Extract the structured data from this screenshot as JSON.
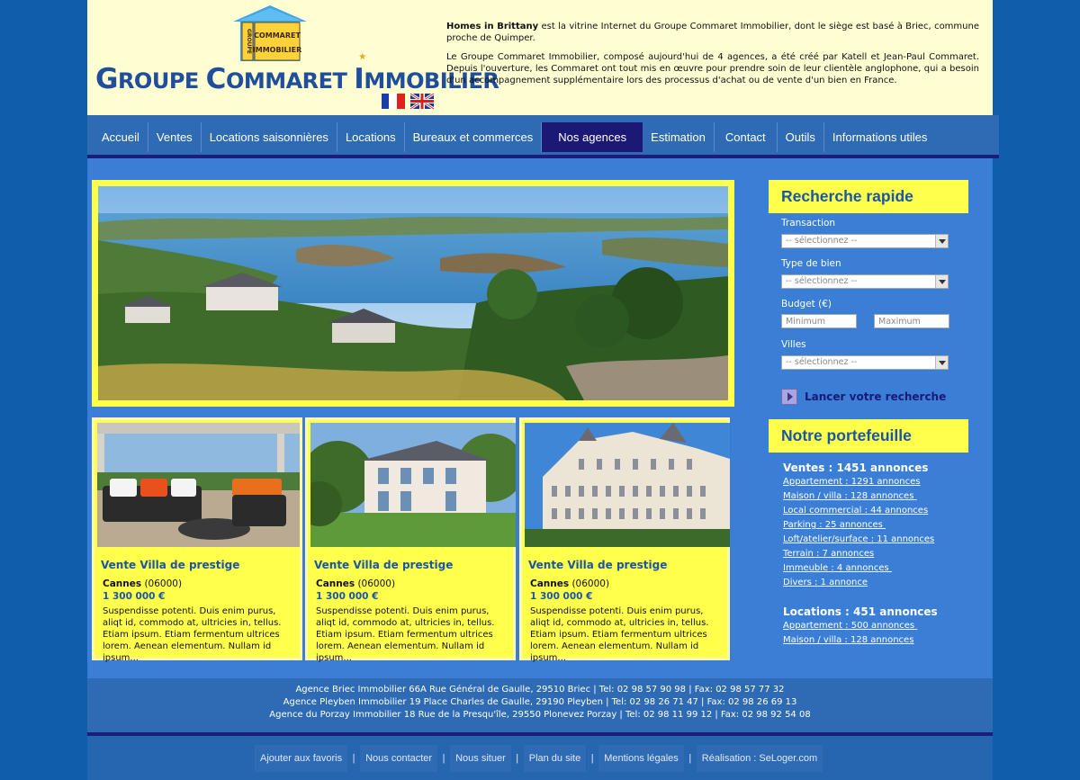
{
  "header": {
    "logo_line1": "COMMARET",
    "logo_line2": "IMMOBILIER",
    "logo_side": "GROUPE",
    "brand_G": "G",
    "brand_roupe": "ROUPE",
    "brand_C": "C",
    "brand_ommaret": "OMMARET",
    "brand_I": "I",
    "brand_mmobilier": "MMOBILIER",
    "intro_strong": "Homes in Brittany",
    "intro_p1": " est la vitrine Internet du Groupe Commaret Immobilier, dont le siège est basé à Briec, commune proche de Quimper.",
    "intro_p2": "Le Groupe Commaret Immobilier, composé aujourd'hui de 4 agences, a été créé par Katell et Jean-Paul Commaret. Depuis l'ouverture, les Commaret ont tout mis en œuvre pour prendre soin de leur clientèle anglophone, qui a besoin d'un accompagnement supplémentaire lors des processus d'achat ou de vente d'un bien en France."
  },
  "nav": {
    "items": [
      {
        "label": "Accueil"
      },
      {
        "label": "Ventes"
      },
      {
        "label": "Locations saisonnières"
      },
      {
        "label": "Locations"
      },
      {
        "label": "Bureaux et commerces"
      },
      {
        "label": "Nos agences"
      },
      {
        "label": "Estimation"
      },
      {
        "label": "Contact"
      },
      {
        "label": "Outils"
      },
      {
        "label": "Informations utiles"
      }
    ],
    "active": "Nos agences"
  },
  "cards": [
    {
      "title": "Vente Villa de prestige",
      "city": "Cannes",
      "zip": " (06000)",
      "price": "1 300 000 €",
      "desc": "Suspendisse potenti. Duis enim purus, aliqt id, commodo at, ultricies in, tellus. Etiam ipsum. Etiam fermentum ultrices lorem. Aenean elementum. Nullam id ipsum..."
    },
    {
      "title": "Vente Villa de prestige",
      "city": "Cannes",
      "zip": " (06000)",
      "price": "1 300 000 €",
      "desc": "Suspendisse potenti. Duis enim purus, aliqt id, commodo at, ultricies in, tellus. Etiam ipsum. Etiam fermentum ultrices lorem. Aenean elementum. Nullam id ipsum..."
    },
    {
      "title": "Vente Villa de prestige",
      "city": "Cannes",
      "zip": " (06000)",
      "price": "1 300 000 €",
      "desc": "Suspendisse potenti. Duis enim purus, aliqt id, commodo at, ultricies in, tellus. Etiam ipsum. Etiam fermentum ultrices lorem. Aenean elementum. Nullam id ipsum..."
    }
  ],
  "search": {
    "title": "Recherche rapide",
    "transaction_label": "Transaction",
    "transaction_value": "-- sélectionnez --",
    "type_label": "Type de bien",
    "type_value": "-- sélectionnez --",
    "budget_label": "Budget (€)",
    "min_placeholder": "Minimum",
    "max_placeholder": "Maximum",
    "villes_label": "Villes",
    "villes_value": "-- sélectionnez --",
    "submit_label": "Lancer votre recherche"
  },
  "portfolio": {
    "title": "Notre portefeuille",
    "ventes_head": "Ventes : 1451 annonces",
    "ventes_links": [
      "Appartement : 1291 annonces",
      "Maison / villa : 128 annonces ",
      "Local commercial : 44 annonces",
      "Parking : 25 annonces ",
      "Loft/atelier/surface : 11 annonces",
      "Terrain : 7 annonces",
      "Immeuble : 4 annonces ",
      "Divers : 1 annonce"
    ],
    "locations_head": "Locations : 451 annonces",
    "locations_links": [
      "Appartement : 500 annonces ",
      "Maison / villa : 128 annonces"
    ]
  },
  "footer": {
    "lines": [
      "Agence Briec Immobilier 66A Rue Général de Gaulle, 29510 Briec  |  Tel: 02 98 57 90 98  |  Fax: 02 98 57 77 32",
      "Agence Pleyben Immobilier 19 Place Charles de Gaulle, 29190 Pleyben  |  Tel: 02 98 26 71 47  |  Fax: 02 98 26 69 13",
      "Agence du Porzay Immobilier 18 Rue de la Presqu'île, 29550 Plonevez Porzay  |  Tel: 02 98 11 99 12  |  Fax: 02 98 92 54 08"
    ],
    "bottom_links": [
      "Ajouter aux favoris",
      "Nous contacter",
      "Nous situer",
      "Plan du site",
      "Mentions légales",
      "Réalisation : SeLoger.com"
    ],
    "separator": "|"
  },
  "colors": {
    "background": "#0f5dab",
    "header_bg": "#fffdd2",
    "nav_bg": "#2e6bb4",
    "nav_active": "#1c1876",
    "main_bg": "#3a7fd5",
    "accent_yellow": "#ffff4c",
    "brand_blue": "#1a56a4"
  }
}
